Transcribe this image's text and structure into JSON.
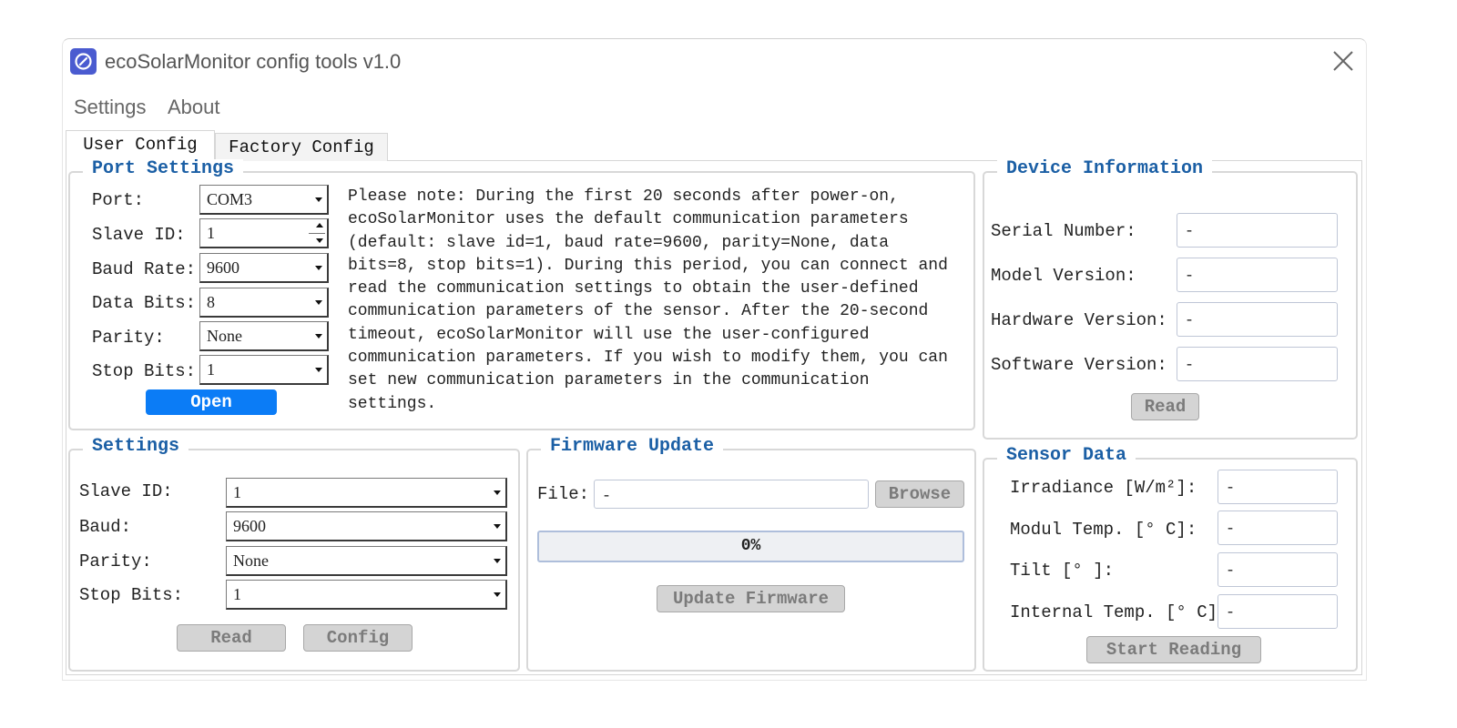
{
  "window": {
    "title": "ecoSolarMonitor config tools v1.0"
  },
  "menu": {
    "settings": "Settings",
    "about": "About"
  },
  "tabs": {
    "user_config": "User Config",
    "factory_config": "Factory Config"
  },
  "port_settings": {
    "title": "Port Settings",
    "port_label": "Port:",
    "port_value": "COM3",
    "slave_label": "Slave ID:",
    "slave_value": "1",
    "baud_label": "Baud Rate:",
    "baud_value": "9600",
    "data_label": "Data Bits:",
    "data_value": "8",
    "parity_label": "Parity:",
    "parity_value": "None",
    "stop_label": "Stop Bits:",
    "stop_value": "1",
    "open_button": "Open",
    "note": "Please note: During the first 20 seconds after power-on,\necoSolarMonitor uses the default communication parameters\n(default: slave id=1, baud rate=9600, parity=None, data\nbits=8, stop bits=1). During this period, you can connect and\nread the communication settings to obtain the user-defined\ncommunication parameters of the sensor. After the 20-second\ntimeout, ecoSolarMonitor will use the user-configured\ncommunication parameters. If you wish to modify them, you can\nset new communication parameters in the communication\nsettings."
  },
  "device_info": {
    "title": "Device Information",
    "serial_label": "Serial Number:",
    "serial_value": "-",
    "model_label": "Model Version:",
    "model_value": "-",
    "hardware_label": "Hardware Version:",
    "hardware_value": "-",
    "software_label": "Software Version:",
    "software_value": "-",
    "read_button": "Read"
  },
  "settings": {
    "title": "Settings",
    "slave_label": "Slave ID:",
    "slave_value": "1",
    "baud_label": "Baud:",
    "baud_value": "9600",
    "parity_label": "Parity:",
    "parity_value": "None",
    "stop_label": "Stop Bits:",
    "stop_value": "1",
    "read_button": "Read",
    "config_button": "Config"
  },
  "firmware": {
    "title": "Firmware Update",
    "file_label": "File:",
    "file_value": "-",
    "browse_button": "Browse",
    "progress_text": "0%",
    "progress_value": 0,
    "update_button": "Update Firmware"
  },
  "sensor": {
    "title": "Sensor Data",
    "irradiance_label": "Irradiance [W/m²]:",
    "irradiance_value": "-",
    "modul_label": "Modul Temp. [° C]:",
    "modul_value": "-",
    "tilt_label": "Tilt [° ]:",
    "tilt_value": "-",
    "internal_label": "Internal Temp. [° C]:",
    "internal_value": "-",
    "start_button": "Start Reading"
  },
  "icons": {
    "app": "gauge-icon",
    "close": "close-icon"
  },
  "colors": {
    "accent": "#0b7cf6",
    "group_title": "#1b5fa5",
    "app_icon": "#4a5bd0"
  }
}
